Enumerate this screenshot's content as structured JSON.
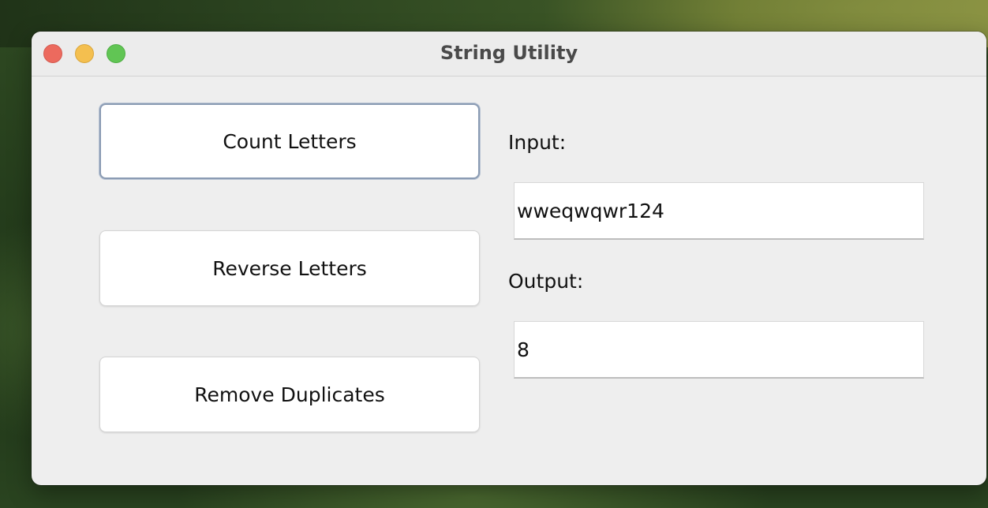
{
  "window": {
    "title": "String Utility"
  },
  "buttons": {
    "count_letters": "Count Letters",
    "reverse_letters": "Reverse Letters",
    "remove_duplicates": "Remove Duplicates"
  },
  "input": {
    "label": "Input:",
    "value": "wweqwqwr124"
  },
  "output": {
    "label": "Output:",
    "value": "8"
  },
  "colors": {
    "window_bg": "#eeeeee",
    "close": "#ec6a5e",
    "minimize": "#f4bf4f",
    "maximize": "#61c554",
    "focus_ring": "#8a9bb3"
  },
  "icons": [
    "close-window-icon",
    "minimize-window-icon",
    "maximize-window-icon"
  ]
}
